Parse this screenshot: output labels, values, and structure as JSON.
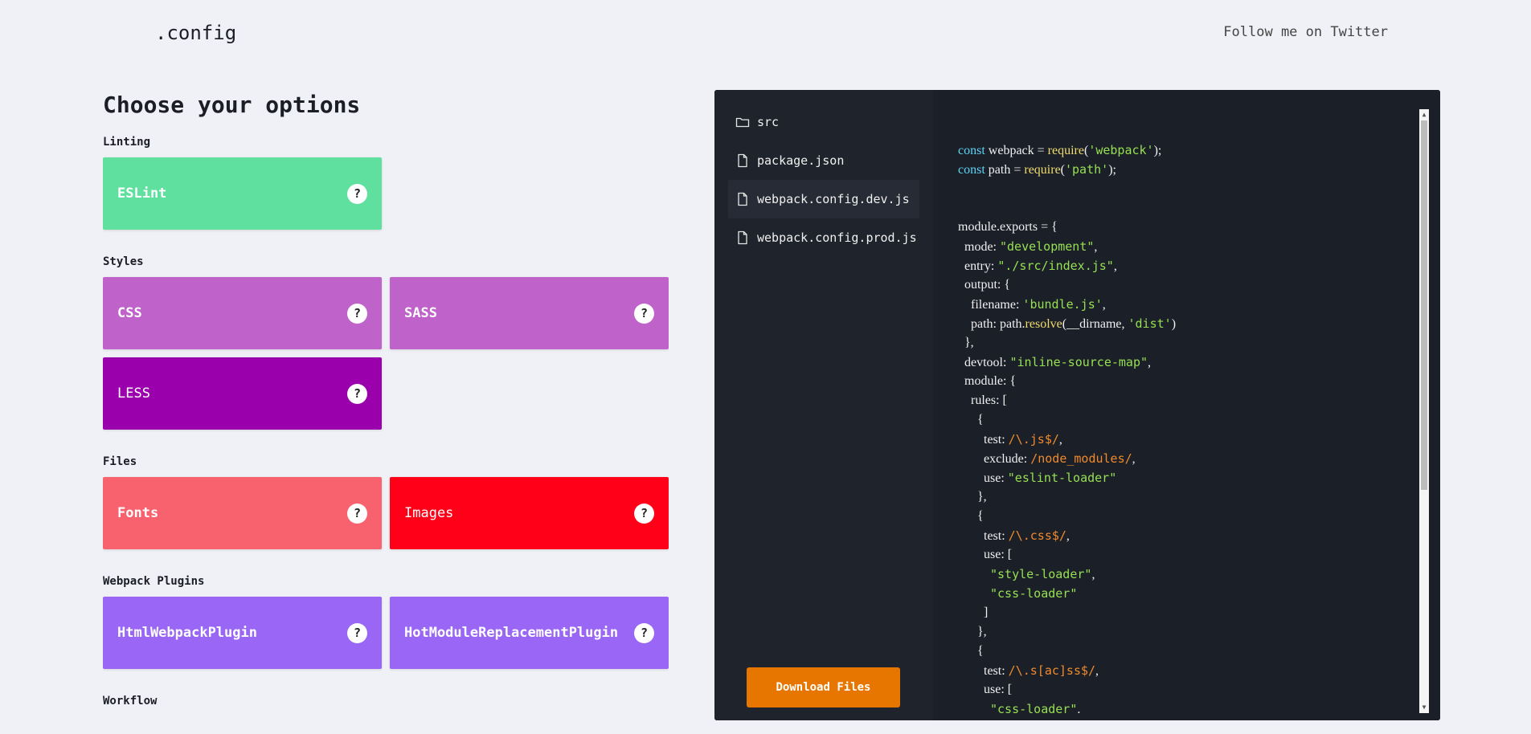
{
  "header": {
    "logo": ".config",
    "twitter_link": "Follow me on Twitter"
  },
  "options": {
    "title": "Choose your options",
    "groups": [
      {
        "label": "Linting",
        "items": [
          {
            "label": "ESLint",
            "color": "#5fe09e",
            "selected": false
          }
        ]
      },
      {
        "label": "Styles",
        "items": [
          {
            "label": "CSS",
            "color": "#bf62c9",
            "selected": false
          },
          {
            "label": "SASS",
            "color": "#bf62c9",
            "selected": false
          },
          {
            "label": "LESS",
            "color": "#9b00ad",
            "selected": true
          }
        ]
      },
      {
        "label": "Files",
        "items": [
          {
            "label": "Fonts",
            "color": "#f7626e",
            "selected": false
          },
          {
            "label": "Images",
            "color": "#ff0018",
            "selected": true
          }
        ]
      },
      {
        "label": "Webpack Plugins",
        "items": [
          {
            "label": "HtmlWebpackPlugin",
            "color": "#9966f5",
            "selected": false
          },
          {
            "label": "HotModuleReplacementPlugin",
            "color": "#9966f5",
            "selected": false
          }
        ]
      },
      {
        "label": "Workflow",
        "items": []
      }
    ],
    "help_glyph": "?"
  },
  "files": [
    {
      "name": "src",
      "icon": "folder-icon",
      "active": false
    },
    {
      "name": "package.json",
      "icon": "file-icon",
      "active": false
    },
    {
      "name": "webpack.config.dev.js",
      "icon": "file-icon",
      "active": true
    },
    {
      "name": "webpack.config.prod.js",
      "icon": "file-icon",
      "active": false
    }
  ],
  "download_label": "Download Files",
  "code_lines": [
    [
      [
        "kw",
        "const"
      ],
      [
        "p",
        " webpack = "
      ],
      [
        "fn",
        "require"
      ],
      [
        "p",
        "("
      ],
      [
        "str",
        "'webpack'"
      ],
      [
        "p",
        ");"
      ]
    ],
    [
      [
        "kw",
        "const"
      ],
      [
        "p",
        " path = "
      ],
      [
        "fn",
        "require"
      ],
      [
        "p",
        "("
      ],
      [
        "str",
        "'path'"
      ],
      [
        "p",
        ");"
      ]
    ],
    [],
    [],
    [
      [
        "p",
        "module.exports = {"
      ]
    ],
    [
      [
        "p",
        "  mode: "
      ],
      [
        "str",
        "\"development\""
      ],
      [
        "p",
        ","
      ]
    ],
    [
      [
        "p",
        "  entry: "
      ],
      [
        "str",
        "\"./src/index.js\""
      ],
      [
        "p",
        ","
      ]
    ],
    [
      [
        "p",
        "  output: {"
      ]
    ],
    [
      [
        "p",
        "    filename: "
      ],
      [
        "str",
        "'bundle.js'"
      ],
      [
        "p",
        ","
      ]
    ],
    [
      [
        "p",
        "    path: path."
      ],
      [
        "fn",
        "resolve"
      ],
      [
        "p",
        "(__dirname, "
      ],
      [
        "str",
        "'dist'"
      ],
      [
        "p",
        ")"
      ]
    ],
    [
      [
        "p",
        "  },"
      ]
    ],
    [
      [
        "p",
        "  devtool: "
      ],
      [
        "str",
        "\"inline-source-map\""
      ],
      [
        "p",
        ","
      ]
    ],
    [
      [
        "p",
        "  module: {"
      ]
    ],
    [
      [
        "p",
        "    rules: ["
      ]
    ],
    [
      [
        "p",
        "      {"
      ]
    ],
    [
      [
        "p",
        "        test: "
      ],
      [
        "rx",
        "/\\.js$/"
      ],
      [
        "p",
        ","
      ]
    ],
    [
      [
        "p",
        "        exclude: "
      ],
      [
        "rx",
        "/node_modules/"
      ],
      [
        "p",
        ","
      ]
    ],
    [
      [
        "p",
        "        use: "
      ],
      [
        "str",
        "\"eslint-loader\""
      ]
    ],
    [
      [
        "p",
        "      },"
      ]
    ],
    [
      [
        "p",
        "      {"
      ]
    ],
    [
      [
        "p",
        "        test: "
      ],
      [
        "rx",
        "/\\.css$/"
      ],
      [
        "p",
        ","
      ]
    ],
    [
      [
        "p",
        "        use: ["
      ]
    ],
    [
      [
        "p",
        "          "
      ],
      [
        "str",
        "\"style-loader\""
      ],
      [
        "p",
        ","
      ]
    ],
    [
      [
        "p",
        "          "
      ],
      [
        "str",
        "\"css-loader\""
      ]
    ],
    [
      [
        "p",
        "        ]"
      ]
    ],
    [
      [
        "p",
        "      },"
      ]
    ],
    [
      [
        "p",
        "      {"
      ]
    ],
    [
      [
        "p",
        "        test: "
      ],
      [
        "rx",
        "/\\.s[ac]ss$/"
      ],
      [
        "p",
        ","
      ]
    ],
    [
      [
        "p",
        "        use: ["
      ]
    ],
    [
      [
        "p",
        "          "
      ],
      [
        "str",
        "\"css-loader\""
      ],
      [
        "p",
        "."
      ]
    ]
  ]
}
